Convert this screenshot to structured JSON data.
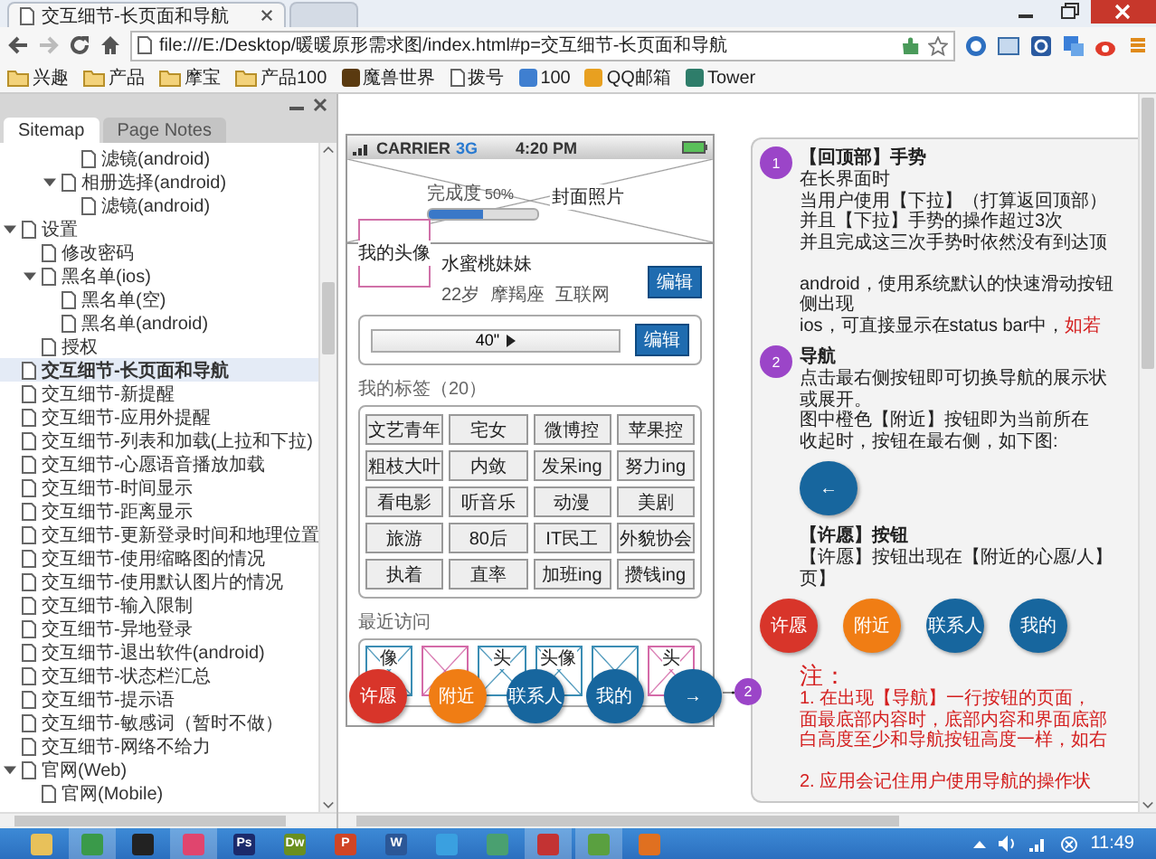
{
  "browser": {
    "tabs": [
      {
        "title": "交互细节-长页面和导航",
        "selected": true
      },
      {
        "selected": false
      }
    ],
    "address": "file:///E:/Desktop/暖暖原形需求图/index.html#p=交互细节-长页面和导航",
    "bookmarks": [
      {
        "kind": "folder",
        "label": "兴趣"
      },
      {
        "kind": "folder",
        "label": "产品"
      },
      {
        "kind": "folder",
        "label": "摩宝"
      },
      {
        "kind": "folder",
        "label": "产品100"
      },
      {
        "kind": "site",
        "label": "魔兽世界",
        "color": "#5a3a10"
      },
      {
        "kind": "page",
        "label": "拨号"
      },
      {
        "kind": "site",
        "label": "100",
        "color": "#3f7fd0"
      },
      {
        "kind": "site",
        "label": "QQ邮箱",
        "color": "#e8a020"
      },
      {
        "kind": "site",
        "label": "Tower",
        "color": "#2e7d6a"
      }
    ]
  },
  "sidebar": {
    "tabs": [
      {
        "label": "Sitemap",
        "selected": true
      },
      {
        "label": "Page Notes",
        "selected": false
      }
    ],
    "tree": [
      {
        "children": [
          {
            "children": [
              {
                "children": [
                  {
                    "label": "滤镜(android)",
                    "selected": false
                  }
                ]
              },
              {
                "label": "相册选择(android)",
                "expanded": true,
                "selected": false,
                "children": [
                  {
                    "label": "滤镜(android)",
                    "selected": false
                  }
                ]
              }
            ]
          }
        ]
      },
      {
        "label": "设置",
        "expanded": true,
        "selected": false,
        "children": [
          {
            "label": "修改密码",
            "selected": false
          },
          {
            "label": "黑名单(ios)",
            "expanded": true,
            "selected": false,
            "children": [
              {
                "label": "黑名单(空)",
                "selected": false
              },
              {
                "label": "黑名单(android)",
                "selected": false
              }
            ]
          },
          {
            "label": "授权",
            "selected": false
          }
        ]
      },
      {
        "label": "交互细节-长页面和导航",
        "selected": true
      },
      {
        "label": "交互细节-新提醒",
        "selected": false
      },
      {
        "label": "交互细节-应用外提醒",
        "selected": false
      },
      {
        "label": "交互细节-列表和加载(上拉和下拉)",
        "selected": false
      },
      {
        "label": "交互细节-心愿语音播放加载",
        "selected": false
      },
      {
        "label": "交互细节-时间显示",
        "selected": false
      },
      {
        "label": "交互细节-距离显示",
        "selected": false
      },
      {
        "label": "交互细节-更新登录时间和地理位置",
        "selected": false
      },
      {
        "label": "交互细节-使用缩略图的情况",
        "selected": false
      },
      {
        "label": "交互细节-使用默认图片的情况",
        "selected": false
      },
      {
        "label": "交互细节-输入限制",
        "selected": false
      },
      {
        "label": "交互细节-异地登录",
        "selected": false
      },
      {
        "label": "交互细节-退出软件(android)",
        "selected": false
      },
      {
        "label": "交互细节-状态栏汇总",
        "selected": false
      },
      {
        "label": "交互细节-提示语",
        "selected": false
      },
      {
        "label": "交互细节-敏感词（暂时不做）",
        "selected": false
      },
      {
        "label": "交互细节-网络不给力",
        "selected": false
      },
      {
        "label": "官网(Web)",
        "expanded": true,
        "selected": false,
        "children": [
          {
            "label": "官网(Mobile)",
            "selected": false
          }
        ]
      }
    ]
  },
  "phone": {
    "status": {
      "carrier": "CARRIER",
      "network": "3G",
      "time": "4:20 PM"
    },
    "cover": {
      "label": "封面照片",
      "progress_label": "完成度",
      "progress_value": "50%",
      "level": 0.5
    },
    "profile": {
      "avatar": "我的头像",
      "name": "水蜜桃妹妹",
      "details": [
        "22岁",
        "摩羯座",
        "互联网"
      ],
      "edit": "编辑"
    },
    "voice": {
      "duration": "40\"",
      "edit": "编辑"
    },
    "tags_title": "我的标签（20）",
    "tags": [
      "文艺青年",
      "宅女",
      "微博控",
      "苹果控",
      "粗枝大叶",
      "内敛",
      "发呆ing",
      "努力ing",
      "看电影",
      "听音乐",
      "动漫",
      "美剧",
      "旅游",
      "80后",
      "IT民工",
      "外貌协会",
      "执着",
      "直率",
      "加班ing",
      "攒钱ing"
    ],
    "recent_title": "最近访问",
    "recent": [
      {
        "text": "像",
        "color": "#3b8db4"
      },
      {
        "color": "#d46aa8"
      },
      {
        "text": "头",
        "color": "#3b8db4"
      },
      {
        "text": "头像",
        "color": "#3b8db4"
      },
      {
        "color": "#3b8db4"
      },
      {
        "text": "头",
        "color": "#d46aa8"
      }
    ],
    "nav": [
      {
        "label": "许愿",
        "color": "#d8352a"
      },
      {
        "label": "附近",
        "color": "#f07d14"
      },
      {
        "label": "联系人",
        "color": "#17669e"
      },
      {
        "label": "我的",
        "color": "#17669e"
      },
      {
        "label": "→",
        "color": "#17669e"
      }
    ]
  },
  "annotation_marker": "2",
  "notes_panel": {
    "blocks": [
      {
        "kind": "numbered",
        "number": "1",
        "title": "【回顶部】手势",
        "lines": [
          {
            "kind": "text",
            "text": "在长界面时"
          },
          {
            "kind": "text",
            "text": "当用户使用【下拉】（打算返回顶部）"
          },
          {
            "kind": "text",
            "text": "并且【下拉】手势的操作超过3次"
          },
          {
            "kind": "text",
            "text": "并且完成这三次手势时依然没有到达顶"
          },
          {
            "kind": "gap"
          },
          {
            "kind": "text",
            "text": "android，使用系统默认的快速滑动按钮"
          },
          {
            "kind": "text",
            "text": "侧出现"
          },
          {
            "kind": "text",
            "text": "ios，可直接显示在status bar中，",
            "suffix": "如若"
          }
        ]
      },
      {
        "kind": "numbered",
        "number": "2",
        "title": "导航",
        "lines": [
          {
            "kind": "text",
            "text": "点击最右侧按钮即可切换导航的展示状"
          },
          {
            "kind": "text",
            "text": "或展开。"
          },
          {
            "kind": "text",
            "text": "图中橙色【附近】按钮即为当前所在"
          },
          {
            "kind": "text",
            "text": "收起时，按钮在最右侧，如下图:"
          }
        ]
      },
      {
        "kind": "round_button",
        "label": "←",
        "color": "#17669e"
      },
      {
        "kind": "heading",
        "title": "【许愿】按钮",
        "lines": [
          {
            "kind": "text",
            "text": "【许愿】按钮出现在【附近的心愿/人】"
          },
          {
            "kind": "text",
            "text": "页】"
          }
        ]
      },
      {
        "kind": "button_row",
        "buttons": [
          {
            "label": "许愿",
            "color": "#d8352a"
          },
          {
            "label": "附近",
            "color": "#f07d14"
          },
          {
            "label": "联系人",
            "color": "#17669e"
          },
          {
            "label": "我的",
            "color": "#17669e"
          }
        ]
      },
      {
        "kind": "remark",
        "title": "注：",
        "lines": [
          {
            "kind": "text",
            "text": "1. 在出现【导航】一行按钮的页面，"
          },
          {
            "kind": "text",
            "text": "面最底部内容时，底部内容和界面底部"
          },
          {
            "kind": "text",
            "text": "白高度至少和导航按钮高度一样，如右"
          },
          {
            "kind": "gap"
          },
          {
            "kind": "text",
            "text": "2. 应用会记住用户使用导航的操作状"
          }
        ]
      }
    ]
  },
  "taskbar": {
    "apps": [
      {
        "color": "#e8c15a",
        "active": false
      },
      {
        "color": "#3a9a4a",
        "active": true
      },
      {
        "color": "#222222",
        "active": false
      },
      {
        "color": "#e0456e",
        "active": true
      },
      {
        "label": "Ps",
        "color": "#1b2a6b",
        "active": false
      },
      {
        "label": "Dw",
        "color": "#6a8f1f",
        "active": false
      },
      {
        "label": "P",
        "color": "#d04525",
        "active": false
      },
      {
        "label": "W",
        "color": "#2b5797",
        "active": false
      },
      {
        "color": "#3aa0e0",
        "active": false
      },
      {
        "color": "#4aa070",
        "active": false
      },
      {
        "color": "#c33333",
        "active": true
      },
      {
        "color": "#5aa040",
        "active": true
      },
      {
        "color": "#e07020",
        "active": false
      }
    ],
    "time": "11:49"
  }
}
